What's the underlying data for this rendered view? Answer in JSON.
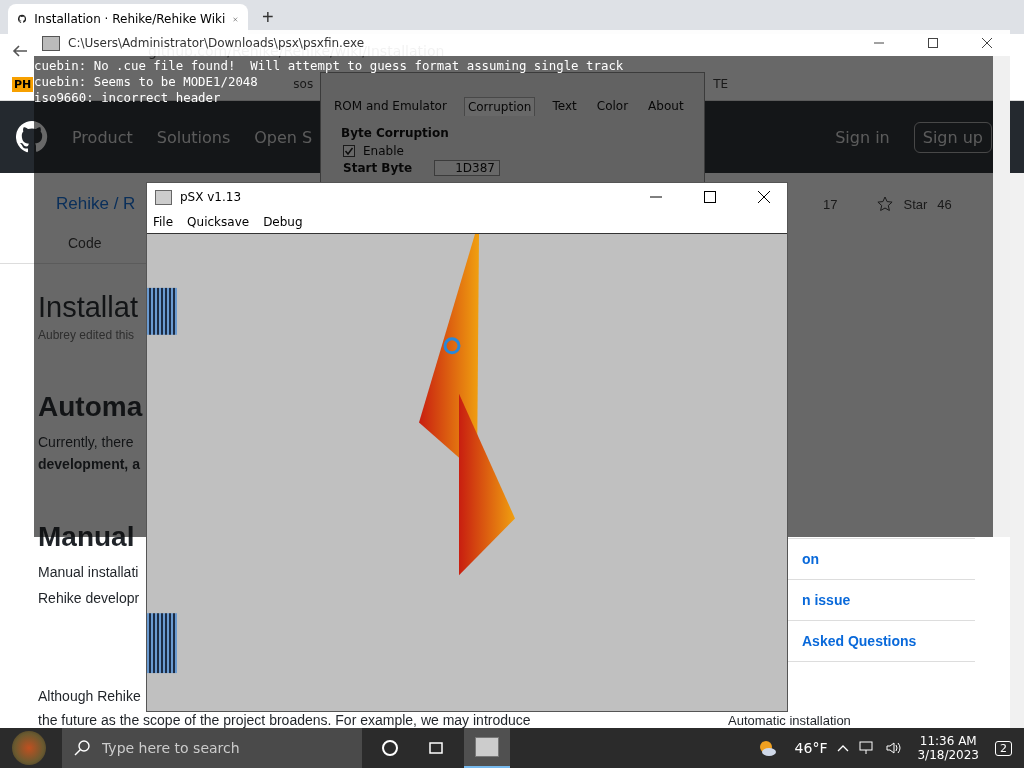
{
  "browser": {
    "tab_title": "Installation · Rehike/Rehike Wiki",
    "new_tab": "+",
    "address": "github.com/Rehike/Rehike/wiki/Installation",
    "bookmarks": [
      {
        "label": "PH",
        "kind": "badge"
      },
      {
        "label": "sos",
        "kind": "text"
      },
      {
        "label": "TE",
        "kind": "text"
      }
    ]
  },
  "github": {
    "nav": [
      "Product",
      "Solutions",
      "Open S"
    ],
    "sign_in": "Sign in",
    "sign_up": "Sign up",
    "repo": "Rehike / R",
    "watch_count": "17",
    "star": "Star",
    "star_count": "46",
    "tab": "Code"
  },
  "content": [
    {
      "kind": "title",
      "text": "Installat"
    },
    {
      "kind": "meta",
      "text": "Aubrey edited this"
    },
    {
      "kind": "heading",
      "text": "Automa"
    },
    {
      "kind": "text",
      "text": "Currently, there"
    },
    {
      "kind": "strong",
      "text": "development, a"
    },
    {
      "kind": "heading",
      "text": "Manual"
    },
    {
      "kind": "text",
      "text": "Manual installati"
    },
    {
      "kind": "text",
      "text": "Rehike developr"
    },
    {
      "kind": "gap",
      "text": "Although Rehike"
    },
    {
      "kind": "wide",
      "text": "the future as the scope of the project broadens. For example, we may introduce"
    }
  ],
  "sidebar": {
    "links": [
      "on",
      "n issue",
      "Asked Questions"
    ],
    "toc": "Automatic installation"
  },
  "corruptor": {
    "tabs": [
      {
        "label": "ROM and Emulator",
        "selected": false
      },
      {
        "label": "Corruption",
        "selected": true
      },
      {
        "label": "Text",
        "selected": false
      },
      {
        "label": "Color",
        "selected": false
      },
      {
        "label": "About",
        "selected": false
      }
    ],
    "group": "Byte Corruption",
    "enable": {
      "label": "Enable",
      "checked": true
    },
    "start_byte": {
      "label": "Start Byte",
      "value": "1D387"
    }
  },
  "console": {
    "title": "C:\\Users\\Administrator\\Downloads\\psx\\psxfin.exe",
    "lines": [
      "cuebin: No .cue file found!  Will attempt to guess format assuming single track",
      "cuebin: Seems to be MODE1/2048",
      "iso9660: incorrect header"
    ]
  },
  "psx": {
    "title": "pSX v1.13",
    "menu": [
      "File",
      "Quicksave",
      "Debug"
    ]
  },
  "taskbar": {
    "search_placeholder": "Type here to search",
    "weather": "46°F",
    "time": "11:36 AM",
    "date": "3/18/2023",
    "notifications": "2"
  }
}
